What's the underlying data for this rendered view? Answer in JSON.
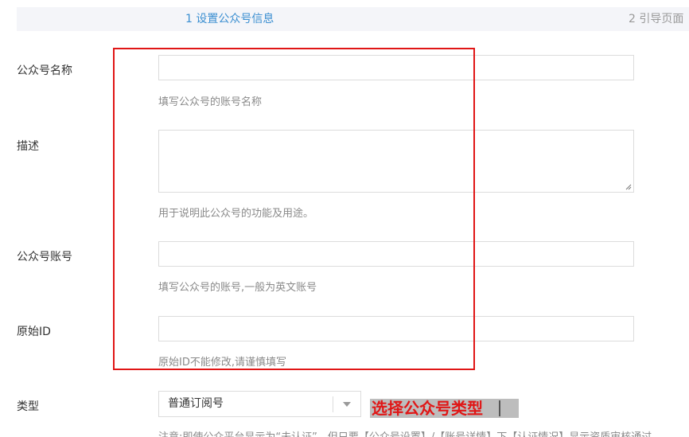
{
  "steps": {
    "active": "1 设置公众号信息",
    "next": "2 引导页面"
  },
  "form": {
    "name": {
      "label": "公众号名称",
      "value": "",
      "hint": "填写公众号的账号名称"
    },
    "description": {
      "label": "描述",
      "value": "",
      "hint": "用于说明此公众号的功能及用途。"
    },
    "account": {
      "label": "公众号账号",
      "value": "",
      "hint": "填写公众号的账号,一般为英文账号"
    },
    "original_id": {
      "label": "原始ID",
      "value": "",
      "hint": "原始ID不能修改,请谨慎填写"
    },
    "type": {
      "label": "类型",
      "selected": "普通订阅号",
      "note": "注意:即使公众平台显示为“未认证”，但只要【公众号设置】/【账号详情】下【认证情况】显示资质审核通过"
    }
  },
  "annotation": {
    "text": "选择公众号类型",
    "color": "#e01616"
  },
  "colors": {
    "accent": "#3b8fd1",
    "highlight": "#e01616"
  }
}
